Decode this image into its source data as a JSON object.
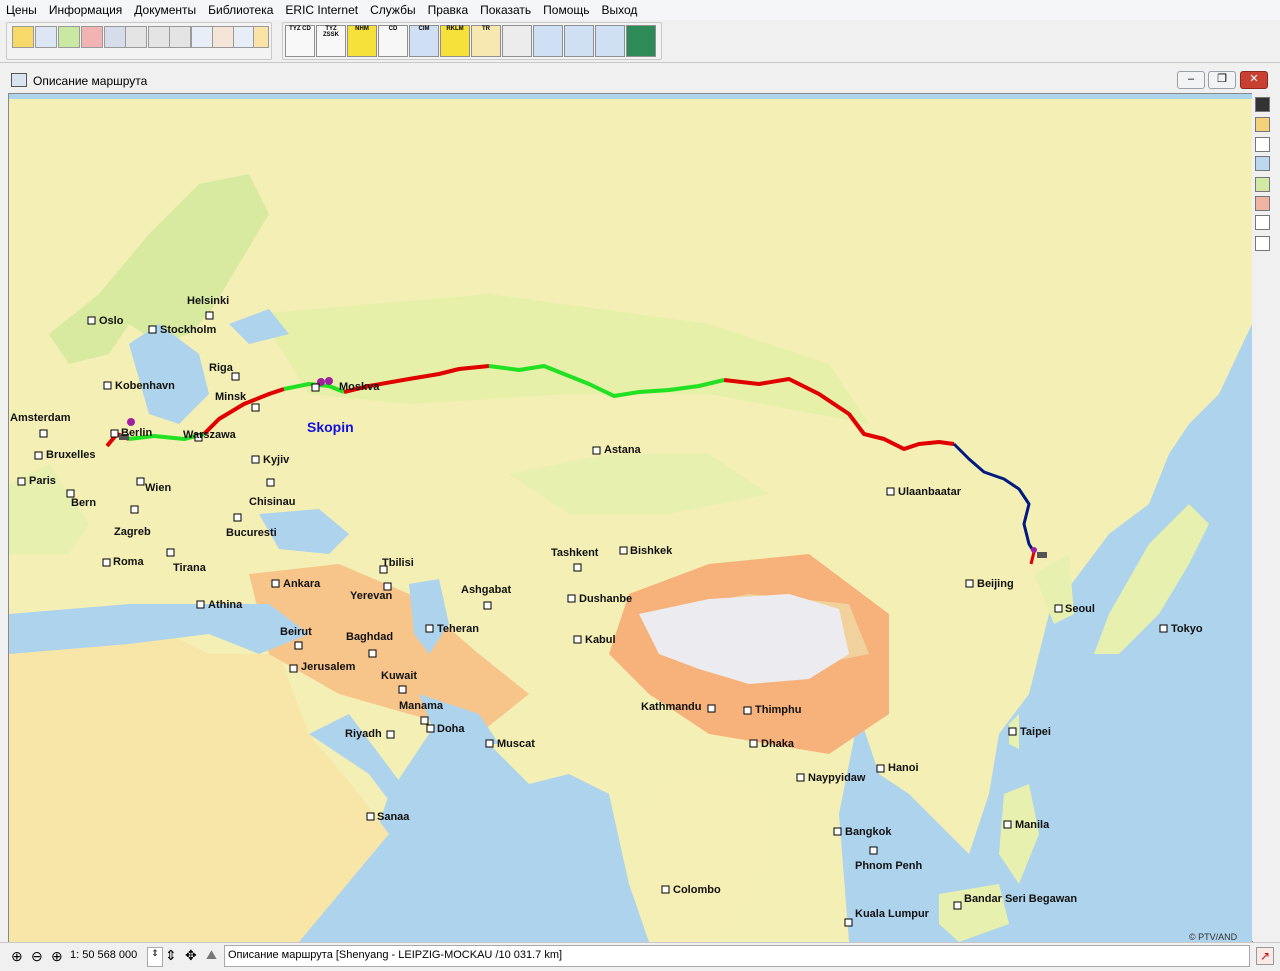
{
  "menu": [
    "Цены",
    "Информация",
    "Документы",
    "Библиотека",
    "ERIC Internet",
    "Службы",
    "Правка",
    "Показать",
    "Помощь",
    "Выход"
  ],
  "toolbar": {
    "group2_labels": [
      "TYZ CD",
      "TYZ ZSSK",
      "NHM",
      "CD",
      "CIM",
      "RKLM",
      "TR"
    ]
  },
  "window": {
    "title": "Описание маршрута",
    "minimize": "‒",
    "restore": "❐",
    "close": "✕"
  },
  "map": {
    "highlight_label": "Skopin",
    "highlight_color": "#1010e0",
    "copyright": "© PTV/AND",
    "cities": [
      {
        "name": "Oslo"
      },
      {
        "name": "Stockholm"
      },
      {
        "name": "Helsinki"
      },
      {
        "name": "Riga"
      },
      {
        "name": "Kobenhavn"
      },
      {
        "name": "Minsk"
      },
      {
        "name": "Amsterdam"
      },
      {
        "name": "Berlin"
      },
      {
        "name": "Warszawa"
      },
      {
        "name": "Bruxelles"
      },
      {
        "name": "Kyjiv"
      },
      {
        "name": "Paris"
      },
      {
        "name": "Wien"
      },
      {
        "name": "Bern"
      },
      {
        "name": "Chisinau"
      },
      {
        "name": "Zagreb"
      },
      {
        "name": "Bucuresti"
      },
      {
        "name": "Roma"
      },
      {
        "name": "Tirana"
      },
      {
        "name": "Athina"
      },
      {
        "name": "Ankara"
      },
      {
        "name": "Tbilisi"
      },
      {
        "name": "Yerevan"
      },
      {
        "name": "Beirut"
      },
      {
        "name": "Jerusalem"
      },
      {
        "name": "Baghdad"
      },
      {
        "name": "Kuwait"
      },
      {
        "name": "Manama"
      },
      {
        "name": "Doha"
      },
      {
        "name": "Riyadh"
      },
      {
        "name": "Muscat"
      },
      {
        "name": "Sanaa"
      },
      {
        "name": "Teheran"
      },
      {
        "name": "Ashgabat"
      },
      {
        "name": "Tashkent"
      },
      {
        "name": "Bishkek"
      },
      {
        "name": "Dushanbe"
      },
      {
        "name": "Kabul"
      },
      {
        "name": "Astana"
      },
      {
        "name": "Ulaanbaatar"
      },
      {
        "name": "Beijing"
      },
      {
        "name": "Seoul"
      },
      {
        "name": "Tokyo"
      },
      {
        "name": "Kathmandu"
      },
      {
        "name": "Thimphu"
      },
      {
        "name": "Dhaka"
      },
      {
        "name": "Naypyidaw"
      },
      {
        "name": "Hanoi"
      },
      {
        "name": "Taipei"
      },
      {
        "name": "Manila"
      },
      {
        "name": "Bangkok"
      },
      {
        "name": "Phnom Penh"
      },
      {
        "name": "Colombo"
      },
      {
        "name": "Kuala Lumpur"
      },
      {
        "name": "Bandar Seri Begawan"
      },
      {
        "name": "Moskva"
      }
    ],
    "route_colors": {
      "red": "#e00000",
      "green": "#22e022",
      "blue": "#001a80"
    }
  },
  "status": {
    "scale": "1: 50 568 000",
    "description": "Описание маршрута [Shenyang - LEIPZIG-MOCKAU /10 031.7 km]"
  }
}
